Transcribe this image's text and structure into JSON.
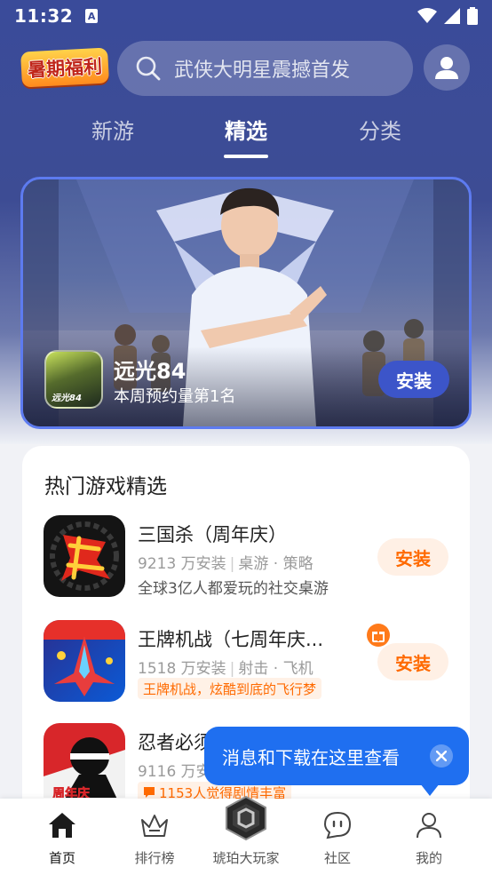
{
  "status_bar": {
    "time": "11:32",
    "notification_glyph": "A"
  },
  "header": {
    "logo_text": "暑期福利",
    "search_placeholder": "武侠大明星震撼首发"
  },
  "tabs": [
    {
      "label": "新游",
      "active": false
    },
    {
      "label": "精选",
      "active": true
    },
    {
      "label": "分类",
      "active": false
    }
  ],
  "banner": {
    "icon_text": "远光84",
    "title": "远光84",
    "subtitle": "本周预约量第1名",
    "install_label": "安装"
  },
  "hot_section": {
    "title": "热门游戏精选",
    "games": [
      {
        "name": "三国杀（周年庆）",
        "downloads": "9213 万安装",
        "category": "桌游 · 策略",
        "desc": "全球3亿人都爱玩的社交桌游",
        "install_label": "安装"
      },
      {
        "name": "王牌机战（七周年庆...",
        "downloads": "1518 万安装",
        "category": "射击 · 飞机",
        "tag": "王牌机战，炫酷到底的飞行梦",
        "install_label": "安装"
      },
      {
        "name": "忍者必须",
        "downloads": "9116 万安",
        "tag": "1153人觉得剧情丰富",
        "icon_text": "周年庆"
      }
    ]
  },
  "tooltip": {
    "text": "消息和下载在这里查看"
  },
  "bottom_nav": [
    {
      "label": "首页",
      "active": true
    },
    {
      "label": "排行榜",
      "active": false
    },
    {
      "label": "琥珀大玩家",
      "active": false
    },
    {
      "label": "社区",
      "active": false
    },
    {
      "label": "我的",
      "active": false
    }
  ],
  "colors": {
    "header_bg": "#3a4b9a",
    "accent_orange": "#ff6a00",
    "banner_install_bg": "#3c55c9",
    "tooltip_bg": "#1f6ff0"
  }
}
